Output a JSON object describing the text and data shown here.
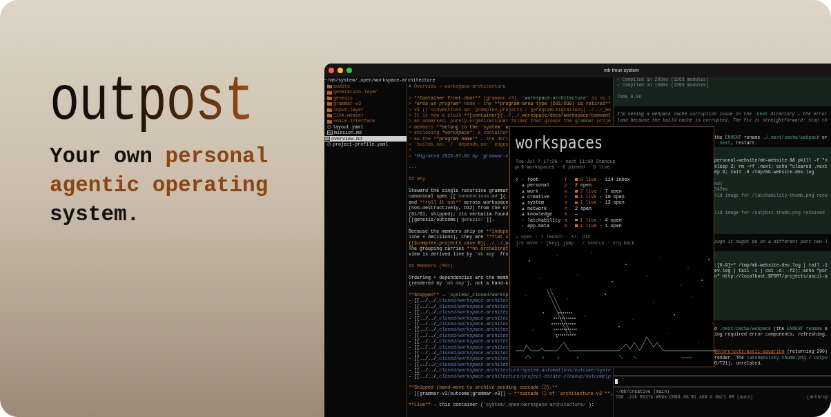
{
  "banner": {
    "logo": "outpost",
    "tagline": [
      [
        {
          "text": "Your own ",
          "accent": false
        },
        {
          "text": "personal",
          "accent": true
        }
      ],
      [
        {
          "text": "agentic operating",
          "accent": true
        }
      ],
      [
        {
          "text": "system.",
          "accent": false
        }
      ]
    ]
  },
  "window": {
    "title": "mb tmux system"
  },
  "file_tree": {
    "path": "~/mb/system/_open/workspace-architecture",
    "items": [
      {
        "name": "audits",
        "kind": "folder",
        "selected": false
      },
      {
        "name": "generation-layer",
        "kind": "folder",
        "selected": false
      },
      {
        "name": "genesis",
        "kind": "folder",
        "selected": false
      },
      {
        "name": "grammar-v3",
        "kind": "folder",
        "selected": false
      },
      {
        "name": "input-layer",
        "kind": "folder",
        "selected": false
      },
      {
        "name": "link-weaver",
        "kind": "folder",
        "selected": false
      },
      {
        "name": "voice-interface",
        "kind": "folder",
        "selected": false
      },
      {
        "name": "layout.yaml",
        "kind": "config",
        "selected": false
      },
      {
        "name": "mission.md",
        "kind": "markdown",
        "selected": false
      },
      {
        "name": "overview.md",
        "kind": "markdown",
        "selected": true
      },
      {
        "name": "project-profile.yaml",
        "kind": "config",
        "selected": false
      }
    ]
  },
  "editor": {
    "lines": [
      {
        "kind": "text",
        "segments": [
          {
            "text": "# Overview — workspace-architecture",
            "kind": "heading"
          }
        ]
      },
      {
        "kind": "blank"
      },
      {
        "kind": "text",
        "segments": [
          {
            "text": "> ",
            "kind": "quote"
          },
          {
            "text": "**Container front-door**",
            "kind": "strong"
          },
          {
            "text": " (grammar v3). ",
            "kind": "quote"
          },
          {
            "text": "`workspace-architecture`",
            "kind": "code"
          },
          {
            "text": " is no l",
            "kind": "quote"
          }
        ]
      },
      {
        "kind": "text",
        "segments": [
          {
            "text": "> ",
            "kind": "quote"
          },
          {
            "text": "*area-as-program*",
            "kind": "emph"
          },
          {
            "text": " node — the ",
            "kind": "quote"
          },
          {
            "text": "**program-area type (D31/D39) is retired**",
            "kind": "strong"
          }
        ]
      },
      {
        "kind": "text",
        "segments": [
          {
            "text": "> v3 ([`conventions.md` §complex-projects / §program-migration](../../_wo",
            "kind": "quote"
          }
        ]
      },
      {
        "kind": "text",
        "segments": [
          {
            "text": "> It is now a plain ",
            "kind": "quote"
          },
          {
            "text": "**[container](../../_workspace/docs/workspace/convent",
            "kind": "strong"
          }
        ]
      },
      {
        "kind": "text",
        "segments": [
          {
            "text": "> an unmarked, purely-organizational folder that groups the grammar proje",
            "kind": "quote"
          }
        ]
      },
      {
        "kind": "text",
        "segments": [
          {
            "text": "> members ",
            "kind": "quote"
          },
          {
            "text": "**belong to the `system` w",
            "kind": "strong"
          }
        ]
      },
      {
        "kind": "text",
        "segments": [
          {
            "text": "> enclosing ",
            "kind": "quote"
          },
          {
            "text": "*workspace*",
            "kind": "emph"
          },
          {
            "text": "; a container",
            "kind": "quote"
          }
        ]
      },
      {
        "kind": "text",
        "segments": [
          {
            "text": "> as the ",
            "kind": "quote"
          },
          {
            "text": "**program name**",
            "kind": "strong"
          },
          {
            "text": " — the deri",
            "kind": "quote"
          }
        ]
      },
      {
        "kind": "text",
        "segments": [
          {
            "text": "> `builds_on:` / `depends_on:` edges",
            "kind": "quote"
          }
        ]
      },
      {
        "kind": "text",
        "segments": [
          {
            "text": ">",
            "kind": "quote"
          }
        ]
      },
      {
        "kind": "text",
        "segments": [
          {
            "text": "> ",
            "kind": "quote"
          },
          {
            "text": "*Migrated 2026-07-02 by `grammar-v",
            "kind": "link"
          }
        ]
      },
      {
        "kind": "blank"
      },
      {
        "kind": "text",
        "segments": [
          {
            "text": "---",
            "kind": "dim"
          }
        ]
      },
      {
        "kind": "blank"
      },
      {
        "kind": "text",
        "segments": [
          {
            "text": "## Why",
            "kind": "heading"
          }
        ]
      },
      {
        "kind": "blank"
      },
      {
        "kind": "text",
        "segments": [
          {
            "text": "Steward the single recursive grammar",
            "kind": "plain"
          }
        ]
      },
      {
        "kind": "text",
        "segments": [
          {
            "text": "canonical spec ([",
            "kind": "plain"
          },
          {
            "text": "`conventions.md`",
            "kind": "code"
          },
          {
            "text": "](.",
            "kind": "plain"
          }
        ]
      },
      {
        "kind": "text",
        "segments": [
          {
            "text": "and ",
            "kind": "plain"
          },
          {
            "text": "**roll it out**",
            "kind": "strong"
          },
          {
            "text": " across workspace",
            "kind": "plain"
          }
        ]
      },
      {
        "kind": "text",
        "segments": [
          {
            "text": "(non-destructively, D32] from the or",
            "kind": "plain"
          }
        ]
      },
      {
        "kind": "text",
        "segments": [
          {
            "text": "(61/61, shipped); its verbatim found",
            "kind": "plain"
          }
        ]
      },
      {
        "kind": "text",
        "segments": [
          {
            "text": "[[genesis/outcome|",
            "kind": "plain"
          },
          {
            "text": "`genesis/`",
            "kind": "code"
          },
          {
            "text": "]].",
            "kind": "plain"
          }
        ]
      },
      {
        "kind": "blank"
      },
      {
        "kind": "text",
        "segments": [
          {
            "text": "Because the members ship on ",
            "kind": "plain"
          },
          {
            "text": "**indepe",
            "kind": "strong"
          }
        ]
      },
      {
        "kind": "text",
        "segments": [
          {
            "text": "line + decisions), they are ",
            "kind": "plain"
          },
          {
            "text": "**flat s",
            "kind": "strong"
          }
        ]
      },
      {
        "kind": "text",
        "segments": [
          {
            "text": "(",
            "kind": "plain"
          },
          {
            "text": "[§complex-projects case B](../../_w",
            "kind": "strong"
          }
        ]
      },
      {
        "kind": "text",
        "segments": [
          {
            "text": "The grouping carries ",
            "kind": "plain"
          },
          {
            "text": "**no orchestrat",
            "kind": "strong"
          }
        ]
      },
      {
        "kind": "text",
        "segments": [
          {
            "text": "view is derived live by ",
            "kind": "plain"
          },
          {
            "text": "`mb map`",
            "kind": "code"
          },
          {
            "text": " fro",
            "kind": "plain"
          }
        ]
      },
      {
        "kind": "blank"
      },
      {
        "kind": "text",
        "segments": [
          {
            "text": "## Members (MOC)",
            "kind": "heading"
          }
        ]
      },
      {
        "kind": "blank"
      },
      {
        "kind": "text",
        "segments": [
          {
            "text": "Ordering + dependencies are the memb",
            "kind": "plain"
          }
        ]
      },
      {
        "kind": "text",
        "segments": [
          {
            "text": "(rendered by ",
            "kind": "plain"
          },
          {
            "text": "`mb map`",
            "kind": "code"
          },
          {
            "text": "), not a hand-k",
            "kind": "plain"
          }
        ]
      },
      {
        "kind": "blank"
      },
      {
        "kind": "text",
        "segments": [
          {
            "text": "**Shipped**",
            "kind": "strong"
          },
          {
            "text": " → ",
            "kind": "plain"
          },
          {
            "text": "`system/_closed/worksp",
            "kind": "code"
          }
        ]
      },
      {
        "kind": "text",
        "segments": [
          {
            "text": "- [[../../",
            "kind": "plain"
          },
          {
            "text": "_closed/workspace-architec",
            "kind": "link"
          }
        ]
      },
      {
        "kind": "text",
        "segments": [
          {
            "text": "- [[../../",
            "kind": "plain"
          },
          {
            "text": "_closed/workspace-architec",
            "kind": "link"
          }
        ]
      },
      {
        "kind": "text",
        "segments": [
          {
            "text": "- [[../../",
            "kind": "plain"
          },
          {
            "text": "_closed/workspace-architec",
            "kind": "link"
          }
        ]
      },
      {
        "kind": "text",
        "segments": [
          {
            "text": "- [[../../",
            "kind": "plain"
          },
          {
            "text": "_closed/workspace-architec",
            "kind": "link"
          }
        ]
      },
      {
        "kind": "text",
        "segments": [
          {
            "text": "- [[../../",
            "kind": "plain"
          },
          {
            "text": "_closed/workspace-architec",
            "kind": "link"
          }
        ]
      },
      {
        "kind": "text",
        "segments": [
          {
            "text": "- [[../../",
            "kind": "plain"
          },
          {
            "text": "_closed/workspace-architec",
            "kind": "link"
          }
        ]
      },
      {
        "kind": "text",
        "segments": [
          {
            "text": "- [[../../",
            "kind": "plain"
          },
          {
            "text": "_closed/workspace-architec",
            "kind": "link"
          }
        ]
      },
      {
        "kind": "text",
        "segments": [
          {
            "text": "- [[../../",
            "kind": "plain"
          },
          {
            "text": "_closed/workspace-architec",
            "kind": "link"
          }
        ]
      },
      {
        "kind": "text",
        "segments": [
          {
            "text": "- [[../../",
            "kind": "plain"
          },
          {
            "text": "_closed/workspace-architec",
            "kind": "link"
          }
        ]
      },
      {
        "kind": "text",
        "segments": [
          {
            "text": "- [[../../",
            "kind": "plain"
          },
          {
            "text": "_closed/workspace-architec",
            "kind": "link"
          }
        ]
      },
      {
        "kind": "text",
        "segments": [
          {
            "text": "- [[../../",
            "kind": "plain"
          },
          {
            "text": "_closed/workspace-architec",
            "kind": "link"
          }
        ]
      },
      {
        "kind": "text",
        "segments": [
          {
            "text": "- [[../../",
            "kind": "plain"
          },
          {
            "text": "_closed/workspace-architec",
            "kind": "link"
          }
        ]
      },
      {
        "kind": "text",
        "segments": [
          {
            "text": "- [[../../",
            "kind": "plain"
          },
          {
            "text": "_closed/workspace-architecture/system-automations/outcome/syste",
            "kind": "link"
          }
        ]
      },
      {
        "kind": "text",
        "segments": [
          {
            "text": "- [[../../",
            "kind": "plain"
          },
          {
            "text": "_closed/workspace-architecture/project-estate-cleanup/outcome|p",
            "kind": "link"
          }
        ]
      },
      {
        "kind": "blank"
      },
      {
        "kind": "text",
        "segments": [
          {
            "text": "**Shipped (band-move to archive pending cascade ⓘ):**",
            "kind": "strong"
          }
        ]
      },
      {
        "kind": "text",
        "segments": [
          {
            "text": "- [[grammar-v3/outcome|grammar-v3]] — ",
            "kind": "plain"
          },
          {
            "text": "**cascade ⓘ of `architecture-v3`**",
            "kind": "strong"
          },
          {
            "text": ",",
            "kind": "plain"
          }
        ]
      },
      {
        "kind": "blank"
      },
      {
        "kind": "text",
        "segments": [
          {
            "text": "**Live**",
            "kind": "strong"
          },
          {
            "text": " → this container (",
            "kind": "plain"
          },
          {
            "text": "`system/_open/workspace-architecture/`",
            "kind": "code"
          },
          {
            "text": "):",
            "kind": "plain"
          }
        ]
      }
    ]
  },
  "session": {
    "rows_above_popup": [
      {
        "kind": "output",
        "segments": [
          {
            "text": "✓ Compiled in 295ms (1263 modules)",
            "kind": "dim"
          }
        ]
      },
      {
        "kind": "output",
        "segments": [
          {
            "text": "✓ Compiled in 168ms (1263 modules)",
            "kind": "dim"
          }
        ]
      },
      {
        "kind": "output"
      },
      {
        "kind": "output",
        "segments": [
          {
            "text": "Took 0.0s",
            "kind": "dim"
          }
        ]
      },
      {
        "kind": "output"
      },
      {
        "kind": "plain"
      },
      {
        "kind": "plain",
        "segments": [
          {
            "text": "I'm seeing a webpack cache corruption issue in the ",
            "kind": "note"
          },
          {
            "text": ".next",
            "kind": "code"
          },
          {
            "text": " directory — the error",
            "kind": "note"
          }
        ]
      },
      {
        "kind": "plain",
        "segments": [
          {
            "text": "load because the build cache is corrupted. The fix is straightforward: stop th",
            "kind": "note"
          }
        ]
      }
    ],
    "rows_beside_popup": [
      {
        "kind": "plain"
      },
      {
        "kind": "plain"
      },
      {
        "kind": "plain",
        "segments": [
          {
            "text": "the ",
            "kind": "plain"
          },
          {
            "text": "ENOENT",
            "kind": "code"
          },
          {
            "text": " rename ",
            "kind": "plain"
          },
          {
            "text": "…/.next/cache/webpack",
            "kind": "code"
          },
          {
            "text": " er",
            "kind": "plain"
          }
        ]
      },
      {
        "kind": "plain",
        "segments": [
          {
            "text": " .next",
            "kind": "code"
          },
          {
            "text": ", restart.",
            "kind": "plain"
          }
        ]
      },
      {
        "kind": "output"
      },
      {
        "kind": "output"
      },
      {
        "kind": "output",
        "segments": [
          {
            "text": "personal-website/mb-website && pkill -f \"n",
            "kind": "plain"
          }
        ]
      },
      {
        "kind": "output",
        "segments": [
          {
            "text": "sleep 2; rm -rf .next; echo \"cleared .next",
            "kind": "plain"
          }
        ]
      },
      {
        "kind": "output",
        "segments": [
          {
            "text": "ep 9; tail -8 /tmp/mb-website-dev.log",
            "kind": "plain"
          }
        ]
      },
      {
        "kind": "output"
      },
      {
        "kind": "output",
        "segments": [
          {
            "text": "nd)",
            "kind": "dim"
          }
        ]
      },
      {
        "kind": "output",
        "segments": [
          {
            "text": "542ms",
            "kind": "dim"
          }
        ]
      },
      {
        "kind": "output",
        "segments": [
          {
            "text": "lid image for /latchability-thumb.png rece",
            "kind": "dim"
          }
        ]
      },
      {
        "kind": "output"
      },
      {
        "kind": "output"
      },
      {
        "kind": "output",
        "segments": [
          {
            "text": "lid image for /outpost-thumb.png received",
            "kind": "dim"
          }
        ]
      },
      {
        "kind": "output"
      },
      {
        "kind": "output"
      },
      {
        "kind": "output"
      },
      {
        "kind": "plain"
      },
      {
        "kind": "plain",
        "segments": [
          {
            "text": "ough it might be on a different port now-l",
            "kind": "note"
          }
        ]
      },
      {
        "kind": "plain"
      },
      {
        "kind": "output"
      },
      {
        "kind": "output"
      },
      {
        "kind": "output",
        "segments": [
          {
            "text": ":[0-9]+\" /tmp/mb-website-dev.log | tail -1",
            "kind": "plain"
          }
        ]
      },
      {
        "kind": "output",
        "segments": [
          {
            "text": "ev.log | tail -1 | cut -d: -f2); echo \"por",
            "kind": "plain"
          }
        ]
      },
      {
        "kind": "output",
        "segments": [
          {
            "text": "n\" http://localhost:$PORT/projects/ascii-a",
            "kind": "plain"
          }
        ]
      },
      {
        "kind": "output"
      },
      {
        "kind": "output"
      },
      {
        "kind": "output"
      },
      {
        "kind": "output"
      },
      {
        "kind": "output"
      },
      {
        "kind": "output"
      },
      {
        "kind": "output"
      },
      {
        "kind": "plain"
      },
      {
        "kind": "plain",
        "segments": [
          {
            "text": "d ",
            "kind": "plain"
          },
          {
            "text": ".next/cache/webpack",
            "kind": "code"
          },
          {
            "text": " (the ",
            "kind": "plain"
          },
          {
            "text": "ENOENT rename",
            "kind": "code"
          },
          {
            "text": " e",
            "kind": "plain"
          }
        ]
      },
      {
        "kind": "plain",
        "segments": [
          {
            "text": "ing required error components, refreshing…",
            "kind": "plain"
          }
        ]
      },
      {
        "kind": "plain"
      },
      {
        "kind": "plain"
      },
      {
        "kind": "plain",
        "segments": [
          {
            "text": "00/projects/ascii-aquarium",
            "kind": "link"
          },
          {
            "text": " (returning 200)",
            "kind": "plain"
          }
        ]
      },
      {
        "kind": "plain",
        "segments": [
          {
            "text": "render. The ",
            "kind": "plain"
          },
          {
            "text": "latchability-thumb.png",
            "kind": "code"
          },
          {
            "text": " / ",
            "kind": "plain"
          },
          {
            "text": "outpo",
            "kind": "code"
          }
        ]
      },
      {
        "kind": "plain",
        "segments": [
          {
            "text": "0/T21), unrelated.",
            "kind": "plain"
          }
        ]
      },
      {
        "kind": "plain"
      }
    ],
    "prompt": {
      "cwd": "~/mb/creative (main)",
      "stats": "T68 ↓23k R937k W59k CH99.4% $1.409 4.6%/1.0M (auto)",
      "model": "(anthrop"
    }
  },
  "workspaces_popup": {
    "logo": "workspaces",
    "date_line": "Tue Jul 7 17:26 · next 11:00 Standup",
    "summary": "9 workspaces · 6 pinned · 6 live",
    "rows": [
      {
        "name": "root",
        "key": "r",
        "kind": "item",
        "selected": true,
        "live": "0 live",
        "status": "· 114 inbox"
      },
      {
        "name": "personal",
        "key": "p",
        "kind": "group",
        "selected": false,
        "status": "2 open"
      },
      {
        "name": "work",
        "key": "w",
        "kind": "group",
        "selected": false,
        "live": "2 live",
        "status": "· 7 open"
      },
      {
        "name": "creative",
        "key": "c",
        "kind": "group",
        "selected": false,
        "live": "1 live",
        "status": "· 10 open"
      },
      {
        "name": "system",
        "key": "s",
        "kind": "group",
        "selected": false,
        "live": "1 live",
        "status": "· 13 open"
      },
      {
        "name": "network",
        "key": "n",
        "kind": "group",
        "selected": false,
        "status": "2 open"
      },
      {
        "name": "knowledge",
        "key": "k",
        "kind": "group",
        "selected": false,
        "status": "—"
      },
      {
        "name": "latchability",
        "key": "a",
        "kind": "item",
        "selected": false,
        "live": "1 live",
        "status": "· 4 open"
      },
      {
        "name": "app-beta",
        "key": "b",
        "kind": "item",
        "selected": false,
        "live": "1 live",
        "status": "· 1 open"
      }
    ],
    "hints": [
      "↵ open · l launch · +/- pin",
      "j/k move · [key] jump · / search · h/q back"
    ]
  }
}
